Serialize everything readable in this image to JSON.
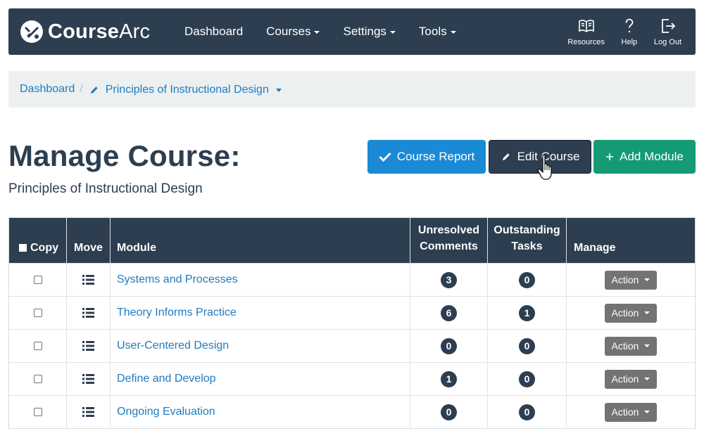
{
  "navbar": {
    "brand": {
      "bold": "Course",
      "light": "Arc"
    },
    "links": [
      {
        "label": "Dashboard",
        "dropdown": false
      },
      {
        "label": "Courses",
        "dropdown": true
      },
      {
        "label": "Settings",
        "dropdown": true
      },
      {
        "label": "Tools",
        "dropdown": true
      }
    ],
    "icons": [
      {
        "label": "Resources",
        "icon": "book-icon"
      },
      {
        "label": "Help",
        "icon": "question-icon"
      },
      {
        "label": "Log Out",
        "icon": "logout-icon"
      }
    ]
  },
  "breadcrumb": {
    "home": "Dashboard",
    "separator": "/",
    "current": "Principles of Instructional Design"
  },
  "header": {
    "title": "Manage Course:",
    "subtitle": "Principles of Instructional Design"
  },
  "buttons": {
    "report": "Course Report",
    "edit": "Edit Course",
    "add": "Add Module"
  },
  "table": {
    "headers": {
      "copy": "Copy",
      "move": "Move",
      "module": "Module",
      "comments_line1": "Unresolved",
      "comments_line2": "Comments",
      "tasks_line1": "Outstanding",
      "tasks_line2": "Tasks",
      "manage": "Manage"
    },
    "action_label": "Action",
    "rows": [
      {
        "module": "Systems and Processes",
        "comments": "3",
        "tasks": "0"
      },
      {
        "module": "Theory Informs Practice",
        "comments": "6",
        "tasks": "1"
      },
      {
        "module": "User-Centered Design",
        "comments": "0",
        "tasks": "0"
      },
      {
        "module": "Define and Develop",
        "comments": "1",
        "tasks": "0"
      },
      {
        "module": "Ongoing Evaluation",
        "comments": "0",
        "tasks": "0"
      }
    ]
  },
  "colors": {
    "navy": "#2c3e50",
    "link": "#1f7bbf",
    "report": "#1a8ad6",
    "add": "#149b76",
    "action": "#737373"
  }
}
